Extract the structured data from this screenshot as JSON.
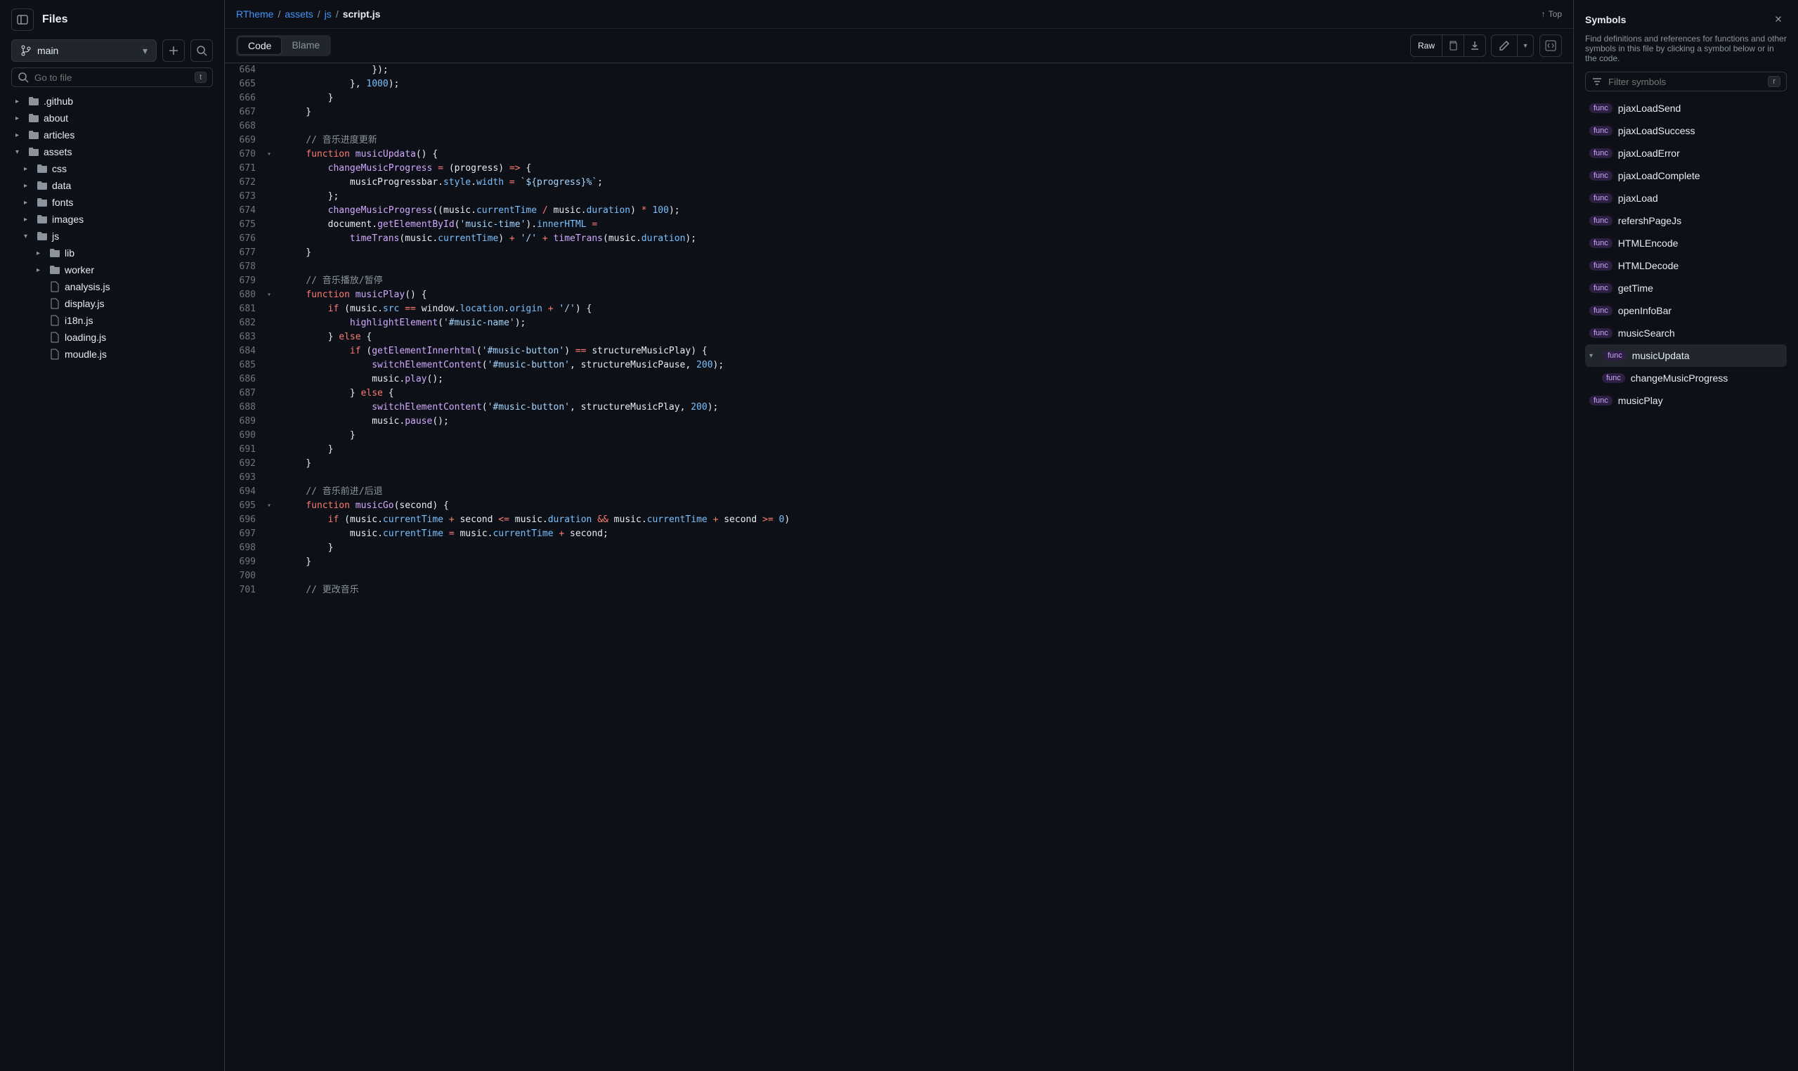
{
  "sidebar": {
    "title": "Files",
    "branch": "main",
    "search_placeholder": "Go to file",
    "search_key": "t",
    "tree": [
      {
        "type": "folder",
        "name": ".github",
        "indent": 0,
        "expanded": false
      },
      {
        "type": "folder",
        "name": "about",
        "indent": 0,
        "expanded": false
      },
      {
        "type": "folder",
        "name": "articles",
        "indent": 0,
        "expanded": false
      },
      {
        "type": "folder",
        "name": "assets",
        "indent": 0,
        "expanded": true
      },
      {
        "type": "folder",
        "name": "css",
        "indent": 1,
        "expanded": false
      },
      {
        "type": "folder",
        "name": "data",
        "indent": 1,
        "expanded": false
      },
      {
        "type": "folder",
        "name": "fonts",
        "indent": 1,
        "expanded": false
      },
      {
        "type": "folder",
        "name": "images",
        "indent": 1,
        "expanded": false
      },
      {
        "type": "folder",
        "name": "js",
        "indent": 1,
        "expanded": true
      },
      {
        "type": "folder",
        "name": "lib",
        "indent": 2,
        "expanded": false
      },
      {
        "type": "folder",
        "name": "worker",
        "indent": 2,
        "expanded": false
      },
      {
        "type": "file",
        "name": "analysis.js",
        "indent": 2
      },
      {
        "type": "file",
        "name": "display.js",
        "indent": 2
      },
      {
        "type": "file",
        "name": "i18n.js",
        "indent": 2
      },
      {
        "type": "file",
        "name": "loading.js",
        "indent": 2
      },
      {
        "type": "file",
        "name": "moudle.js",
        "indent": 2
      }
    ]
  },
  "breadcrumb": {
    "parts": [
      "RTheme",
      "assets",
      "js"
    ],
    "current": "script.js",
    "top_label": "Top"
  },
  "toolbar": {
    "tabs": {
      "code": "Code",
      "blame": "Blame"
    },
    "raw": "Raw"
  },
  "code": {
    "lines": [
      {
        "n": 664,
        "html": "                }<span class='tok-id'>)</span>;"
      },
      {
        "n": 665,
        "html": "            }, <span class='tok-num'>1000</span>);"
      },
      {
        "n": 666,
        "html": "        }"
      },
      {
        "n": 667,
        "html": "    }"
      },
      {
        "n": 668,
        "html": ""
      },
      {
        "n": 669,
        "html": "    <span class='tok-com'>// 音乐进度更新</span>"
      },
      {
        "n": 670,
        "fold": true,
        "html": "    <span class='tok-kw'>function</span> <span class='tok-fn'>musicUpdata</span>() {"
      },
      {
        "n": 671,
        "html": "        <span class='tok-fn'>changeMusicProgress</span> <span class='tok-kw'>=</span> (<span class='tok-id'>progress</span>) <span class='tok-kw'>=></span> {"
      },
      {
        "n": 672,
        "html": "            <span class='tok-id'>musicProgressbar</span>.<span class='tok-prop'>style</span>.<span class='tok-prop'>width</span> <span class='tok-kw'>=</span> <span class='tok-str'>`${progress}%`</span>;"
      },
      {
        "n": 673,
        "html": "        };"
      },
      {
        "n": 674,
        "html": "        <span class='tok-fn'>changeMusicProgress</span>((<span class='tok-id'>music</span>.<span class='tok-prop'>currentTime</span> <span class='tok-kw'>/</span> <span class='tok-id'>music</span>.<span class='tok-prop'>duration</span>) <span class='tok-kw'>*</span> <span class='tok-num'>100</span>);"
      },
      {
        "n": 675,
        "html": "        <span class='tok-id'>document</span>.<span class='tok-fn'>getElementById</span>(<span class='tok-str'>'music-time'</span>).<span class='tok-prop'>innerHTML</span> <span class='tok-kw'>=</span>"
      },
      {
        "n": 676,
        "html": "            <span class='tok-fn'>timeTrans</span>(<span class='tok-id'>music</span>.<span class='tok-prop'>currentTime</span>) <span class='tok-kw'>+</span> <span class='tok-str'>'/'</span> <span class='tok-kw'>+</span> <span class='tok-fn'>timeTrans</span>(<span class='tok-id'>music</span>.<span class='tok-prop'>duration</span>);"
      },
      {
        "n": 677,
        "html": "    }"
      },
      {
        "n": 678,
        "html": ""
      },
      {
        "n": 679,
        "html": "    <span class='tok-com'>// 音乐播放/暂停</span>"
      },
      {
        "n": 680,
        "fold": true,
        "html": "    <span class='tok-kw'>function</span> <span class='tok-fn'>musicPlay</span>() {"
      },
      {
        "n": 681,
        "html": "        <span class='tok-kw'>if</span> (<span class='tok-id'>music</span>.<span class='tok-prop'>src</span> <span class='tok-kw'>==</span> <span class='tok-id'>window</span>.<span class='tok-prop'>location</span>.<span class='tok-prop'>origin</span> <span class='tok-kw'>+</span> <span class='tok-str'>'/'</span>) {"
      },
      {
        "n": 682,
        "html": "            <span class='tok-fn'>highlightElement</span>(<span class='tok-str'>'#music-name'</span>);"
      },
      {
        "n": 683,
        "html": "        } <span class='tok-kw'>else</span> {"
      },
      {
        "n": 684,
        "html": "            <span class='tok-kw'>if</span> (<span class='tok-fn'>getElementInnerhtml</span>(<span class='tok-str'>'#music-button'</span>) <span class='tok-kw'>==</span> <span class='tok-id'>structureMusicPlay</span>) {"
      },
      {
        "n": 685,
        "html": "                <span class='tok-fn'>switchElementContent</span>(<span class='tok-str'>'#music-button'</span>, <span class='tok-id'>structureMusicPause</span>, <span class='tok-num'>200</span>);"
      },
      {
        "n": 686,
        "html": "                <span class='tok-id'>music</span>.<span class='tok-fn'>play</span>();"
      },
      {
        "n": 687,
        "html": "            } <span class='tok-kw'>else</span> {"
      },
      {
        "n": 688,
        "html": "                <span class='tok-fn'>switchElementContent</span>(<span class='tok-str'>'#music-button'</span>, <span class='tok-id'>structureMusicPlay</span>, <span class='tok-num'>200</span>);"
      },
      {
        "n": 689,
        "html": "                <span class='tok-id'>music</span>.<span class='tok-fn'>pause</span>();"
      },
      {
        "n": 690,
        "html": "            }"
      },
      {
        "n": 691,
        "html": "        }"
      },
      {
        "n": 692,
        "html": "    }"
      },
      {
        "n": 693,
        "html": ""
      },
      {
        "n": 694,
        "html": "    <span class='tok-com'>// 音乐前进/后退</span>"
      },
      {
        "n": 695,
        "fold": true,
        "html": "    <span class='tok-kw'>function</span> <span class='tok-fn'>musicGo</span>(<span class='tok-id'>second</span>) {"
      },
      {
        "n": 696,
        "html": "        <span class='tok-kw'>if</span> (<span class='tok-id'>music</span>.<span class='tok-prop'>currentTime</span> <span class='tok-kw'>+</span> <span class='tok-id'>second</span> <span class='tok-kw'><=</span> <span class='tok-id'>music</span>.<span class='tok-prop'>duration</span> <span class='tok-kw'>&&</span> <span class='tok-id'>music</span>.<span class='tok-prop'>currentTime</span> <span class='tok-kw'>+</span> <span class='tok-id'>second</span> <span class='tok-kw'>>=</span> <span class='tok-num'>0</span>)"
      },
      {
        "n": 697,
        "html": "            <span class='tok-id'>music</span>.<span class='tok-prop'>currentTime</span> <span class='tok-kw'>=</span> <span class='tok-id'>music</span>.<span class='tok-prop'>currentTime</span> <span class='tok-kw'>+</span> <span class='tok-id'>second</span>;"
      },
      {
        "n": 698,
        "html": "        }"
      },
      {
        "n": 699,
        "html": "    }"
      },
      {
        "n": 700,
        "html": ""
      },
      {
        "n": 701,
        "html": "    <span class='tok-com'>// 更改音乐</span>"
      }
    ]
  },
  "symbols": {
    "title": "Symbols",
    "description": "Find definitions and references for functions and other symbols in this file by clicking a symbol below or in the code.",
    "filter_placeholder": "Filter symbols",
    "filter_key": "r",
    "list": [
      {
        "name": "pjaxLoadSend",
        "type": "func"
      },
      {
        "name": "pjaxLoadSuccess",
        "type": "func"
      },
      {
        "name": "pjaxLoadError",
        "type": "func"
      },
      {
        "name": "pjaxLoadComplete",
        "type": "func"
      },
      {
        "name": "pjaxLoad",
        "type": "func"
      },
      {
        "name": "refershPageJs",
        "type": "func"
      },
      {
        "name": "HTMLEncode",
        "type": "func"
      },
      {
        "name": "HTMLDecode",
        "type": "func"
      },
      {
        "name": "getTime",
        "type": "func"
      },
      {
        "name": "openInfoBar",
        "type": "func"
      },
      {
        "name": "musicSearch",
        "type": "func"
      },
      {
        "name": "musicUpdata",
        "type": "func",
        "expanded": true
      },
      {
        "name": "changeMusicProgress",
        "type": "func",
        "indent": true
      },
      {
        "name": "musicPlay",
        "type": "func"
      }
    ]
  }
}
